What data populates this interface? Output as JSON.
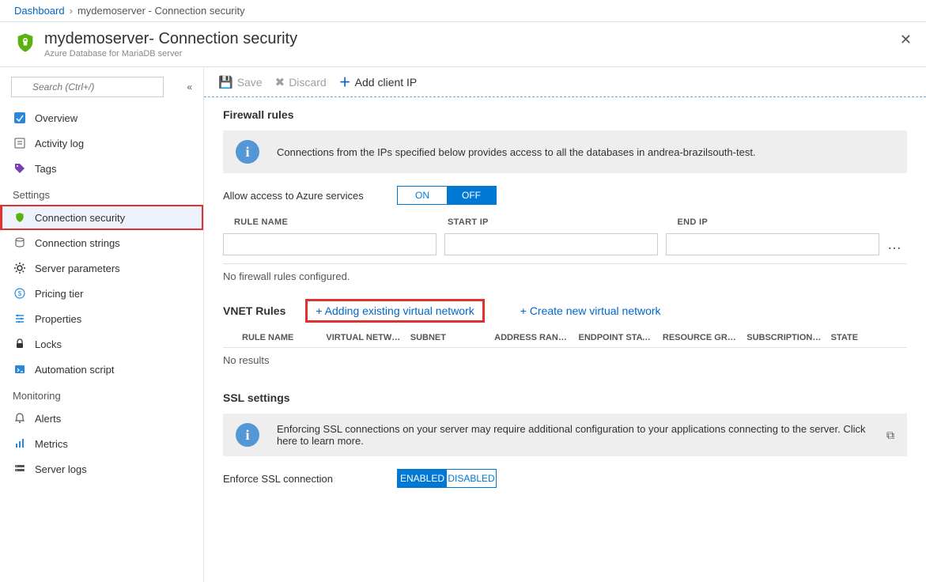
{
  "breadcrumb": {
    "root": "Dashboard",
    "current": "mydemoserver - Connection security"
  },
  "header": {
    "title": "mydemoserver- Connection security",
    "subtitle": "Azure Database for MariaDB server"
  },
  "sidebar": {
    "search_placeholder": "Search (Ctrl+/)",
    "items_top": [
      {
        "label": "Overview"
      },
      {
        "label": "Activity log"
      },
      {
        "label": "Tags"
      }
    ],
    "group_settings": "Settings",
    "items_settings": [
      {
        "label": "Connection security"
      },
      {
        "label": "Connection strings"
      },
      {
        "label": "Server parameters"
      },
      {
        "label": "Pricing tier"
      },
      {
        "label": "Properties"
      },
      {
        "label": "Locks"
      },
      {
        "label": "Automation script"
      }
    ],
    "group_monitoring": "Monitoring",
    "items_monitoring": [
      {
        "label": "Alerts"
      },
      {
        "label": "Metrics"
      },
      {
        "label": "Server logs"
      }
    ]
  },
  "toolbar": {
    "save": "Save",
    "discard": "Discard",
    "add_client_ip": "Add client IP"
  },
  "firewall": {
    "title": "Firewall rules",
    "info": "Connections from the IPs specified below provides access to all the databases in andrea-brazilsouth-test.",
    "allow_label": "Allow access to Azure services",
    "toggle_on": "ON",
    "toggle_off": "OFF",
    "col_rule": "RULE NAME",
    "col_start": "START IP",
    "col_end": "END IP",
    "empty": "No firewall rules configured."
  },
  "vnet": {
    "title": "VNET Rules",
    "add_existing": "+ Adding existing virtual network",
    "create_new": "+ Create new virtual network",
    "cols": {
      "rule": "RULE NAME",
      "vn": "VIRTUAL NETWO…",
      "subnet": "SUBNET",
      "addr": "ADDRESS RANGE",
      "endpoint": "ENDPOINT STAT…",
      "rg": "RESOURCE GROUP",
      "sub": "SUBSCRIPTION ID",
      "state": "STATE"
    },
    "empty": "No results"
  },
  "ssl": {
    "title": "SSL settings",
    "info": "Enforcing SSL connections on your server may require additional configuration to your applications connecting to the server.  Click here to learn more.",
    "enforce_label": "Enforce SSL connection",
    "enabled": "ENABLED",
    "disabled": "DISABLED"
  }
}
